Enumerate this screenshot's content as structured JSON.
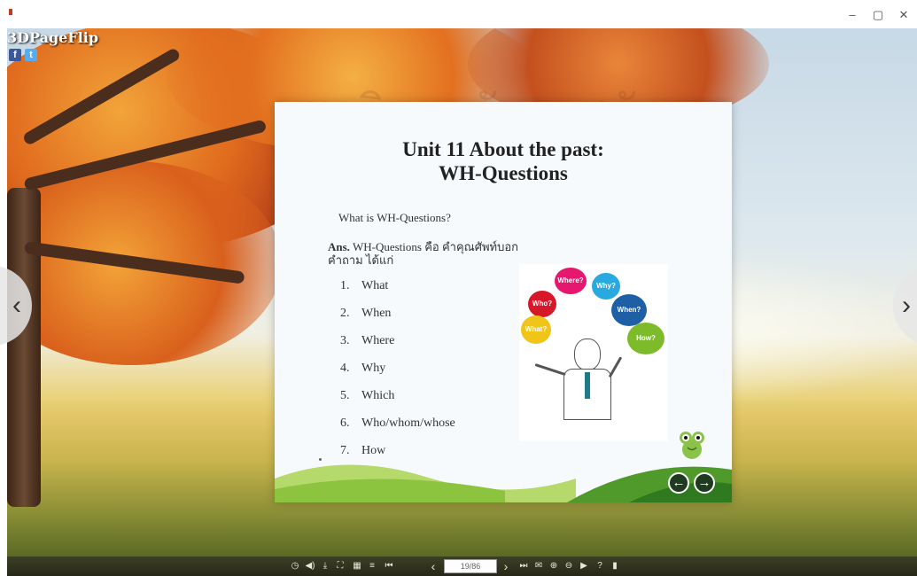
{
  "window": {
    "minimize_glyph": "–",
    "maximize_glyph": "▢",
    "close_glyph": "✕"
  },
  "brand": {
    "name": "3DPageFlip",
    "facebook_icon": "f",
    "twitter_icon": "t"
  },
  "watermark": {
    "text": "มหาวิทยาลัยราชภัฏ"
  },
  "navigation": {
    "prev_glyph": "‹",
    "next_glyph": "›"
  },
  "page": {
    "title_line1": "Unit 11 About the past:",
    "title_line2": "WH-Questions",
    "question": "What is WH-Questions?",
    "answer_label": "Ans.",
    "answer_text": "WH-Questions คือ คำคุณศัพท์บอกคำถาม ได้แก่",
    "list": [
      {
        "num": "1.",
        "text": "What"
      },
      {
        "num": "2.",
        "text": "When"
      },
      {
        "num": "3.",
        "text": "Where"
      },
      {
        "num": "4.",
        "text": "Why"
      },
      {
        "num": "5.",
        "text": "Which"
      },
      {
        "num": "6.",
        "text": "Who/whom/whose"
      },
      {
        "num": "7.",
        "text": "How"
      }
    ],
    "bubbles": [
      {
        "text": "Where?",
        "color": "#e6176e"
      },
      {
        "text": "Why?",
        "color": "#29a9e0"
      },
      {
        "text": "Who?",
        "color": "#d7182a"
      },
      {
        "text": "When?",
        "color": "#1e5fa6"
      },
      {
        "text": "What?",
        "color": "#f0c419"
      },
      {
        "text": "How?",
        "color": "#7dbb2a"
      }
    ],
    "back_glyph": "←",
    "forward_glyph": "→"
  },
  "toolbar": {
    "page_indicator": "19/86",
    "icons": [
      "info-icon",
      "sound-icon",
      "download-icon",
      "fullscreen-icon",
      "thumbnails-icon",
      "toc-icon",
      "first-page-icon",
      "prev-page-icon",
      "next-page-icon",
      "last-page-icon",
      "email-icon",
      "zoom-in-icon",
      "zoom-out-icon",
      "autoplay-icon",
      "help-icon",
      "bookmark-icon"
    ],
    "glyphs": {
      "info": "◷",
      "sound": "◀)",
      "download": "⤓",
      "fullscreen": "⛶",
      "thumbnails": "▦",
      "toc": "≡",
      "first": "⏮",
      "prev": "‹",
      "next": "›",
      "last": "⏭",
      "email": "✉",
      "zoom_in": "⊕",
      "zoom_out": "⊖",
      "autoplay": "▶",
      "help": "?",
      "bookmark": "▮"
    }
  }
}
